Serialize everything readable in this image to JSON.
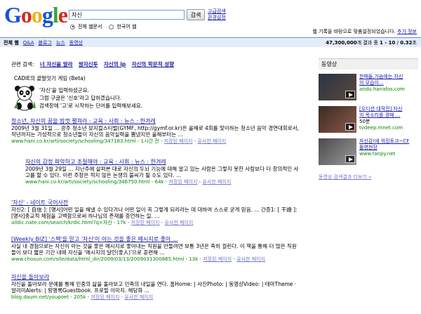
{
  "header": {
    "logo_letters": [
      "G",
      "o",
      "o",
      "g",
      "l",
      "e"
    ],
    "logo_colors": [
      "#1551e0",
      "#d52b1e",
      "#eeb211",
      "#1551e0",
      "#3ba53b",
      "#d52b1e"
    ],
    "search_value": "자신",
    "search_button": "검색",
    "advanced_search": "고급검색",
    "preferences": "환경설정",
    "scope_web": "전체 웹문서",
    "scope_korean": "한국어 웹",
    "history_note": "웹 기록을 바탕으로 맞춤설정되었습니다.",
    "history_more": "추가 정보"
  },
  "tabs": [
    {
      "label": "전체 웹",
      "active": true
    },
    {
      "label": "Q&A",
      "active": false
    },
    {
      "label": "블로그",
      "active": false
    },
    {
      "label": "뉴스",
      "active": false
    },
    {
      "label": "동영상",
      "active": false
    }
  ],
  "stats": {
    "count": "47,300,000",
    "text1": "개 결과 중",
    "range": "1 - 10",
    "text2": "/",
    "time": "0.32",
    "unit": "초"
  },
  "related": {
    "label": "관련 검색:",
    "links": [
      "너 자신을 알라",
      "쌍자신투",
      "자신의 ip",
      "자신의 학문적 성향"
    ]
  },
  "onebox": {
    "title": "CADIE의 끝말잇기 게임 (Beta)",
    "lines": [
      "'자신'을 입력하셨군요.",
      "그럼 구글은 '신호'라고 답하겠습니다.",
      "검색창에 '고'로 시작하는 단어를 입력해보세요."
    ]
  },
  "results": [
    {
      "title": "청소년, 자신의 꿈을 맘껏 펼쳐라 : 교육 : 사회 : 뉴스 : 한겨레",
      "snippet": "2009년 3월 31일 ... 광주 청소년 뮤지컬스티벌(GYMF, http://gymf.or.kr)은 올해로 4회를 맞이하는 청소년 음악 경연대회로서, 작년까지는 가성적으로 청소년들이 자신의 음악실력을 뽐냈지만 올해부터는 ...",
      "url": "www.hani.co.kr/arti/society/schooling/347183.html",
      "meta": "1시간 전",
      "links": [
        "저장된 페이지",
        "유사한 페이지"
      ]
    },
    {
      "title": "자신의 감정 파악하고 조절해야 : 교육 : 사회 : 뉴스 : 한겨레",
      "snippet": "2009년 3월 29일 ... 지난주에 살펴본 대로 자신의 두뇌 기능에 대해 알고 있는 사람은 그렇지 못한 사람보다 더 창의적인 사고를 할 수 있다. 이런 주장은 적지 않은 논쟁의 불씨가 될 수도 있다. ...",
      "url": "www.hani.co.kr/arti/society/schooling/346750.html",
      "meta": "64k",
      "links": [
        "저장된 페이지",
        "유사한 페이지"
      ]
    },
    {
      "title": "'자신' - 네이트 국어사전",
      "snippet": "자신2: [ 自信 ]: [명사]어떤 일을 해낼 수 있다거나 어떤 일이 꼭 그렇게 되리라는 데 대하여 스스로 굳게 믿음. ... 간증1: [ 干證 ]: [명사]종교적 체험을 고백함으로써 하나님의 존재를 증언하는 일. ...",
      "url": "alldic.nate.com/search/krdic.html?q=자신",
      "meta": "17k",
      "links": [
        "저장된 페이지",
        "유사한 페이지"
      ]
    },
    {
      "title": "[Weekly BIZ] '스펙'을 믿고 '자신'이 아는 것을 좋은 메시지로 좋아 ...",
      "snippet": "사실 내 경험으로는 자신이 아는 것을 좋은 메시지로 좋아내는 직원을 만들려면 보통 3년은 족히 걸린다. 이 책을 통해 더 많은 직원들이 보다 짧은 기간 내에 자신을 '메시지의 달인(좋人)'으로 훈련해 ...",
      "url": "www.chosun.com/site/data/html_dir/2009/03/13/2009031300865.html",
      "meta": "13k",
      "links": [
        "저장된 페이지",
        "유사한 페이지"
      ]
    },
    {
      "title": "자신을 돌아보라",
      "snippet": "자신을 돌아보라 문예를 통해 민중의 삶을 돌아보고 민족의 내일을 연다. 홈Home: | 사진Photo: | 동영상Video: | 테마Theme · 알리미Alerts: | 방명록Guestbook. 프로필 이미지. 해당화 ...",
      "url": "blog.daum.net/youpoet",
      "meta": "205k",
      "links": [
        "저장된 페이지",
        "유사한 페이지"
      ]
    }
  ],
  "videos": {
    "heading": "동영상",
    "items": [
      {
        "title": "한때들,가슴에는 자신",
        "sub": "의 모습이...",
        "source": "andu.hanafos.com"
      },
      {
        "title": "[오디션 대작전] 자신",
        "sub": "의 목소리를 경매 ...",
        "source": "50분",
        "source2": "tvdeep.mnet.com"
      },
      {
        "title": "자신감!에 워킹토크~CF",
        "sub": "촬영현장",
        "source": "www.fanpy.net"
      }
    ],
    "more": "동영상 검색결과 더보기 »"
  }
}
